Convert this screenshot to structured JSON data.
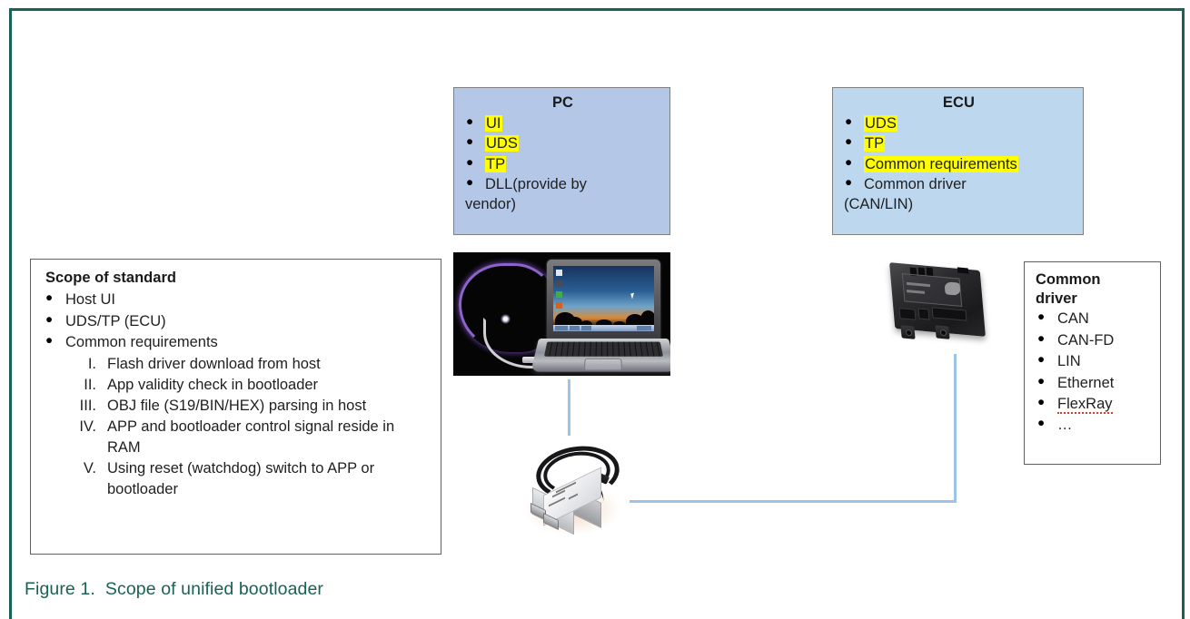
{
  "figure": {
    "caption": "Figure 1.  Scope of unified bootloader",
    "border_color": "#1a6156",
    "caption_color": "#1a6156",
    "highlight_color": "#ffff00",
    "connector_color": "#9dc3e6"
  },
  "pc_box": {
    "title": "PC",
    "fill_color": "#b4c7e7",
    "items": [
      {
        "text": "UI",
        "highlighted": true
      },
      {
        "text": "UDS",
        "highlighted": true
      },
      {
        "text": "TP",
        "highlighted": true
      },
      {
        "text": "DLL(provide by",
        "continuation": "vendor)",
        "highlighted": false
      }
    ]
  },
  "ecu_box": {
    "title": "ECU",
    "fill_color": "#bdd7ee",
    "items": [
      {
        "text": "UDS",
        "highlighted": true
      },
      {
        "text": "TP",
        "highlighted": true
      },
      {
        "text": "Common requirements",
        "highlighted": true
      },
      {
        "text": "Common driver",
        "continuation": "(CAN/LIN)",
        "highlighted": false
      }
    ]
  },
  "scope_box": {
    "title": "Scope of standard",
    "bullets": [
      "Host UI",
      "UDS/TP (ECU)",
      "Common requirements"
    ],
    "numbered": [
      {
        "numeral": "I.",
        "text": "Flash driver download from host"
      },
      {
        "numeral": "II.",
        "text": "App validity check in bootloader"
      },
      {
        "numeral": "III.",
        "text": "OBJ file (S19/BIN/HEX) parsing in host"
      },
      {
        "numeral": "IV.",
        "text": "APP and bootloader control signal reside in RAM"
      },
      {
        "numeral": "V.",
        "text": "Using reset (watchdog) switch to APP or bootloader"
      }
    ]
  },
  "driver_box": {
    "title": "Common driver",
    "items": [
      {
        "text": "CAN",
        "spellcheck_error": false
      },
      {
        "text": "CAN-FD",
        "spellcheck_error": false
      },
      {
        "text": "LIN",
        "spellcheck_error": false
      },
      {
        "text": "Ethernet",
        "spellcheck_error": false
      },
      {
        "text": "FlexRay",
        "spellcheck_error": true
      },
      {
        "text": "…",
        "spellcheck_error": false
      }
    ]
  },
  "images": {
    "laptop": "laptop-with-glowing-cable-photo",
    "ecu_module": "black-ecu-module-photo",
    "adapter": "can-interface-adapter-photo"
  }
}
